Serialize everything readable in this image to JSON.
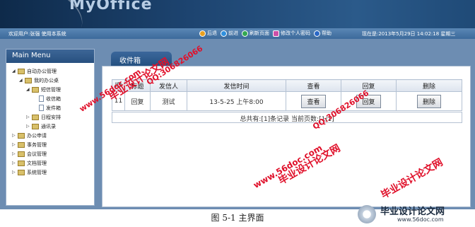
{
  "header": {
    "logo_text": "MyOffice"
  },
  "statusbar": {
    "welcome": "欢迎用户:张强 使用本系统",
    "actions": [
      {
        "label": "后退",
        "icon": "back-icon"
      },
      {
        "label": "前进",
        "icon": "forward-icon"
      },
      {
        "label": "刷新页面",
        "icon": "refresh-icon"
      },
      {
        "label": "修改个人密码",
        "icon": "lock-icon"
      },
      {
        "label": "帮助",
        "icon": "help-icon"
      }
    ],
    "now": "现在是:2013年5月29日 14:02:18 星期三"
  },
  "sidebar": {
    "title": "Main Menu",
    "items": [
      {
        "label": "自动办公管理",
        "level": 0,
        "type": "folder",
        "expanded": true
      },
      {
        "label": "我的办公桌",
        "level": 1,
        "type": "folder",
        "expanded": true
      },
      {
        "label": "短信管理",
        "level": 2,
        "type": "folder",
        "expanded": true
      },
      {
        "label": "收信箱",
        "level": 3,
        "type": "doc"
      },
      {
        "label": "发件箱",
        "level": 3,
        "type": "doc"
      },
      {
        "label": "日程安排",
        "level": 2,
        "type": "folder",
        "expanded": false
      },
      {
        "label": "通讯录",
        "level": 2,
        "type": "folder",
        "expanded": false
      },
      {
        "label": "办公申请",
        "level": 0,
        "type": "folder",
        "expanded": false
      },
      {
        "label": "事务管理",
        "level": 0,
        "type": "folder",
        "expanded": false
      },
      {
        "label": "会议管理",
        "level": 0,
        "type": "folder",
        "expanded": false
      },
      {
        "label": "文档管理",
        "level": 0,
        "type": "folder",
        "expanded": false
      },
      {
        "label": "系统管理",
        "level": 0,
        "type": "folder",
        "expanded": false
      }
    ]
  },
  "main": {
    "tab_label": "收件箱",
    "table": {
      "headers": [
        "ID",
        "标题",
        "发信人",
        "发信时间",
        "查看",
        "回复",
        "删除"
      ],
      "rows": [
        {
          "id": "11",
          "title": "回复",
          "sender": "测试",
          "time": "13-5-25 上午8:00",
          "view": "查看",
          "reply": "回复",
          "delete": "删除"
        }
      ]
    },
    "pager": "总共有:[1]条记录  当前页数:[1/1]"
  },
  "watermarks": [
    "毕业设计论文网",
    "QQ:306826066",
    "www.56doc.com"
  ],
  "caption": "图 5-1 主界面",
  "brand": {
    "name": "毕业设计论文网",
    "url": "www.56doc.com"
  },
  "colors": {
    "banner": "#1d4470",
    "panel": "#6d8db2",
    "watermark": "#e0102a"
  }
}
